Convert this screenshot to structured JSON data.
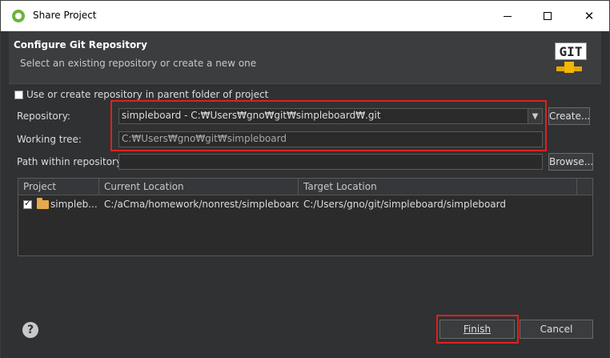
{
  "window": {
    "title": "Share Project"
  },
  "banner": {
    "heading": "Configure Git Repository",
    "description": "Select an existing repository or create a new one",
    "logo_text": "GIT"
  },
  "options": {
    "use_parent_label": "Use or create repository in parent folder of project",
    "use_parent_checked": false
  },
  "repository": {
    "label": "Repository:",
    "value": "simpleboard - C:₩Users₩gno₩git₩simpleboard₩.git",
    "create_label": "Create..."
  },
  "working_tree": {
    "label": "Working tree:",
    "value": "C:₩Users₩gno₩git₩simpleboard"
  },
  "path": {
    "label": "Path within repository:",
    "value": "",
    "browse_label": "Browse..."
  },
  "table": {
    "columns": [
      "Project",
      "Current Location",
      "Target Location"
    ],
    "rows": [
      {
        "project": "simpleb...",
        "current": "C:/aCma/homework/nonrest/simpleboard",
        "target": "C:/Users/gno/git/simpleboard/simpleboard",
        "checked": true
      }
    ]
  },
  "footer": {
    "finish_label": "Finish",
    "cancel_label": "Cancel"
  },
  "colors": {
    "highlight": "#e0201d",
    "background": "#2f3133"
  }
}
